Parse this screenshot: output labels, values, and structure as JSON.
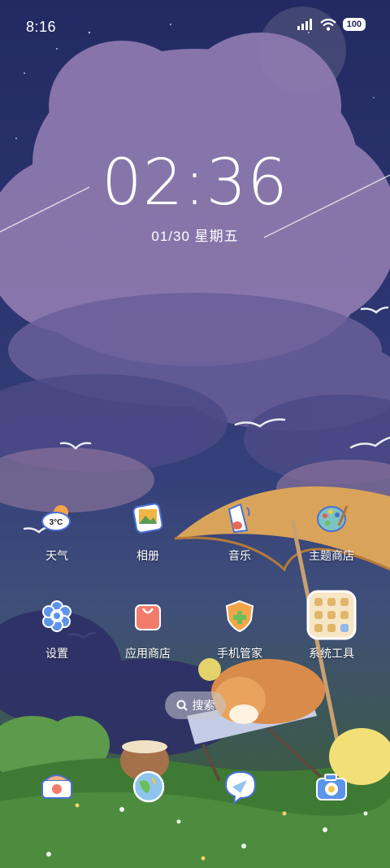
{
  "status_bar": {
    "time": "8:16",
    "battery": "100"
  },
  "lockscreen": {
    "clock": "02:36",
    "date": "01/30 星期五"
  },
  "apps": {
    "weather": {
      "label": "天气",
      "temp": "3°C"
    },
    "gallery": {
      "label": "相册"
    },
    "music": {
      "label": "音乐"
    },
    "themes": {
      "label": "主题商店"
    },
    "settings": {
      "label": "设置"
    },
    "app_store": {
      "label": "应用商店"
    },
    "security": {
      "label": "手机管家"
    },
    "tools": {
      "label": "系统工具"
    }
  },
  "search": {
    "label": "搜索"
  },
  "colors": {
    "sky": "#232a63",
    "cloud": "#8a7fb0",
    "grass": "#3c6a34",
    "umbrella": "#d9a45a"
  }
}
